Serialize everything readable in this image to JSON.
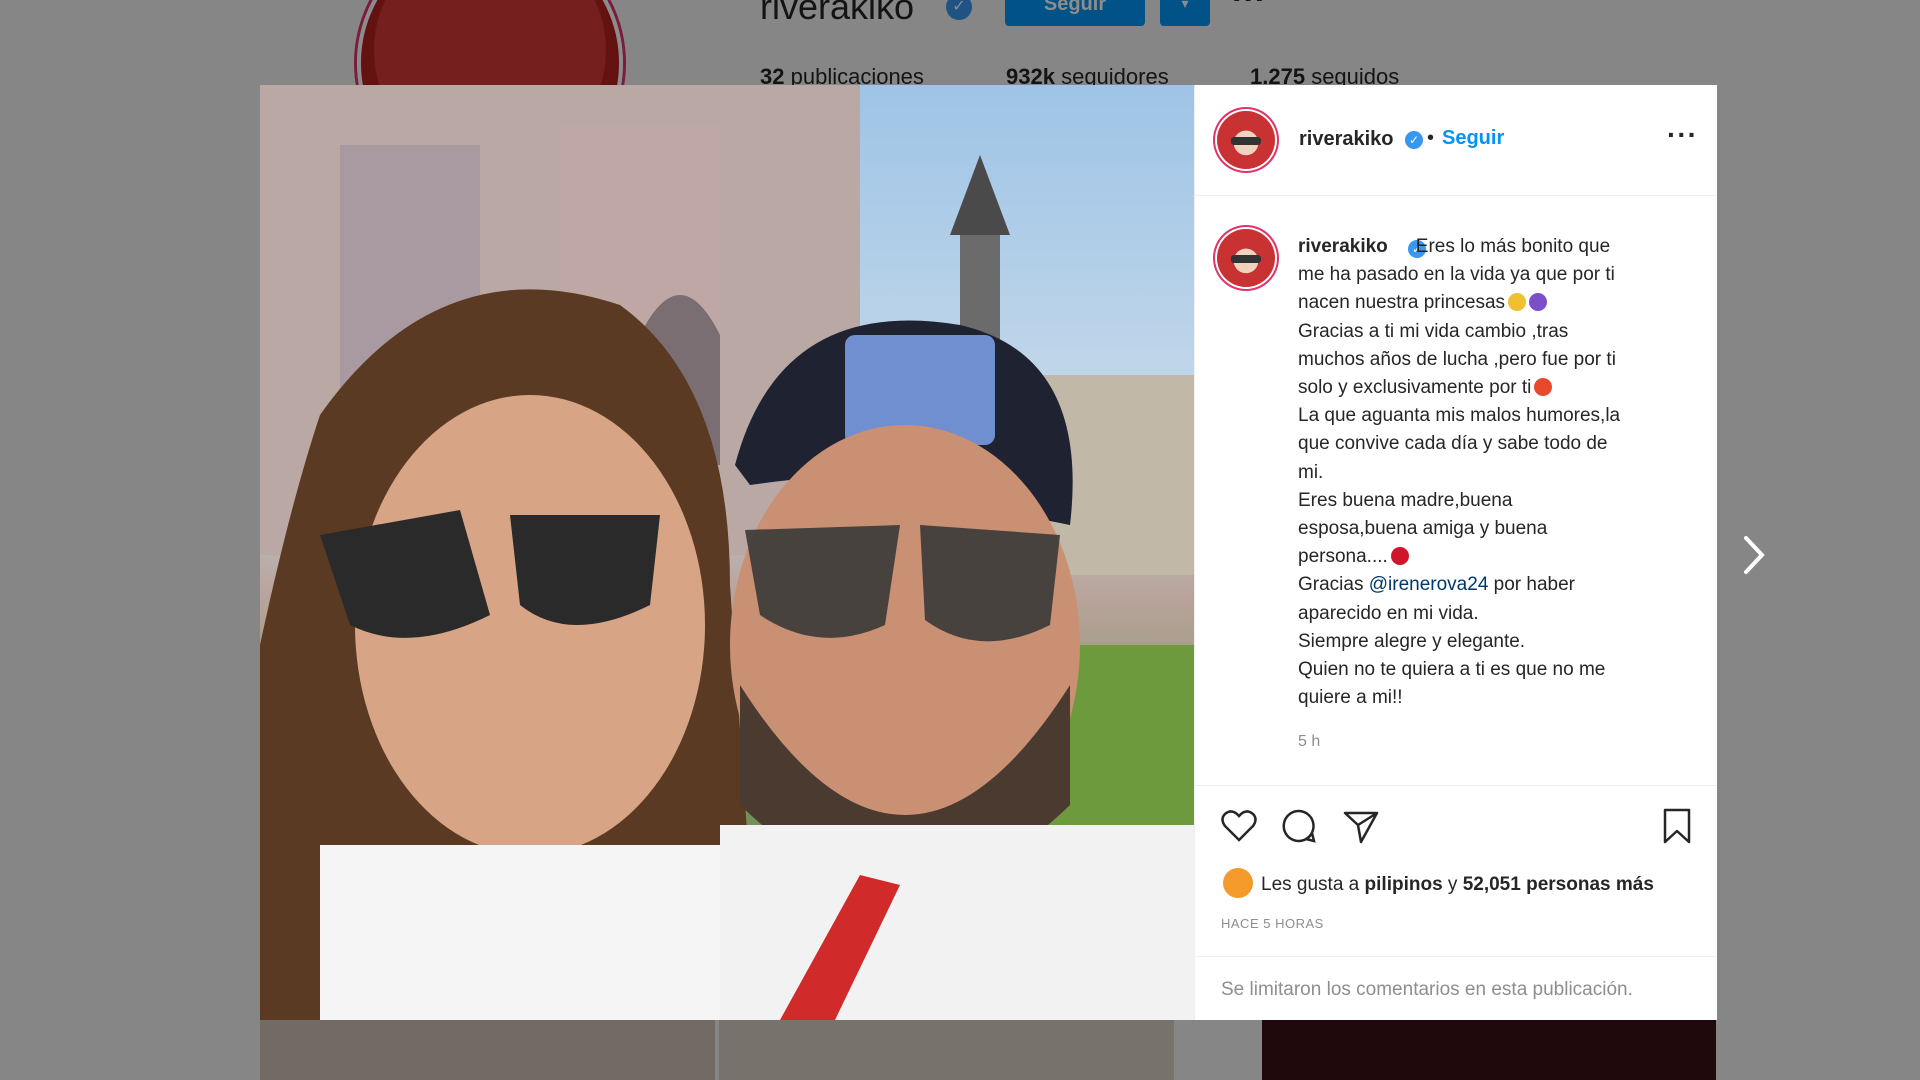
{
  "background_profile": {
    "username": "riverakiko",
    "follow_label": "Seguir",
    "stats": [
      {
        "value": "32",
        "label": "publicaciones"
      },
      {
        "value": "932k",
        "label": "seguidores"
      },
      {
        "value": "1.275",
        "label": "seguidos"
      }
    ]
  },
  "post": {
    "header": {
      "username": "riverakiko",
      "separator": "•",
      "follow_label": "Seguir",
      "more_label": "···"
    },
    "caption": {
      "username": "riverakiko",
      "lines": [
        "Eres lo más bonito que",
        "me ha pasado en la vida ya que por ti",
        "nacen nuestra princesas",
        "Gracias a ti mi vida cambio ,tras",
        "muchos años de lucha ,pero fue por ti",
        "solo y exclusivamente por ti",
        "La que aguanta mis malos humores,la",
        "que convive cada día y sabe todo de",
        "mi.",
        "Eres buena madre,buena",
        "esposa,buena amiga y buena",
        "persona....",
        "Gracias ",
        "aparecido en mi vida.",
        "Siempre alegre y elegante.",
        "Quien no te quiera a ti es que no me",
        "quiere a mi!!"
      ],
      "mention": "@irenerova24",
      "after_mention": " por haber",
      "time": "5 h"
    },
    "likes": {
      "prefix": "Les gusta a ",
      "user": "pilipinos",
      "middle": " y ",
      "count": "52,051 personas más"
    },
    "timestamp": "HACE 5 HORAS",
    "comments_notice": "Se limitaron los comentarios en esta publicación.",
    "icons": [
      "heart-icon",
      "comment-icon",
      "share-icon",
      "bookmark-icon",
      "chevron-right-icon"
    ],
    "colors": {
      "link": "#0095f6",
      "verified": "#3897f0",
      "likes_dot": "#f39a2b",
      "ring": "#e0336b"
    }
  }
}
